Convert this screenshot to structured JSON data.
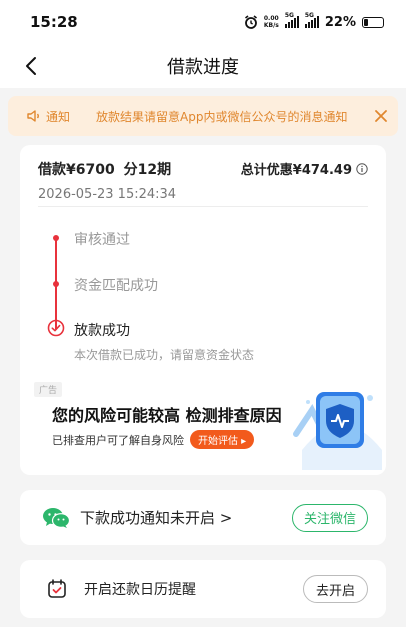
{
  "status_bar": {
    "time": "15:28",
    "net_speed_value": "0.00",
    "net_speed_unit": "KB/s",
    "signal1_label": "5G",
    "signal2_label": "5G",
    "battery": "22%"
  },
  "nav": {
    "title": "借款进度"
  },
  "notice": {
    "label": "通知",
    "text": "放款结果请留意App内或微信公众号的消息通知"
  },
  "loan": {
    "amount": "借款¥6700",
    "term": "分12期",
    "discount": "总计优惠¥474.49",
    "time": "2026-05-23 15:24:34"
  },
  "timeline": {
    "step1": "审核通过",
    "step2": "资金匹配成功",
    "step3": "放款成功",
    "step3_sub": "本次借款已成功，请留意资金状态"
  },
  "ad": {
    "tag": "广告",
    "title": "您的风险可能较高 检测排查原因",
    "subtitle": "已排查用户可了解自身风险",
    "button": "开始评估 ▸"
  },
  "wechat": {
    "text": "下款成功通知未开启 >",
    "button": "关注微信"
  },
  "calendar": {
    "text": "开启还款日历提醒",
    "button": "去开启"
  },
  "colors": {
    "accent_red": "#e8323c",
    "notice_orange": "#e0872e",
    "notice_bg": "#fdeedd",
    "wechat_green": "#2cb66b",
    "ad_orange": "#f25a1c"
  }
}
